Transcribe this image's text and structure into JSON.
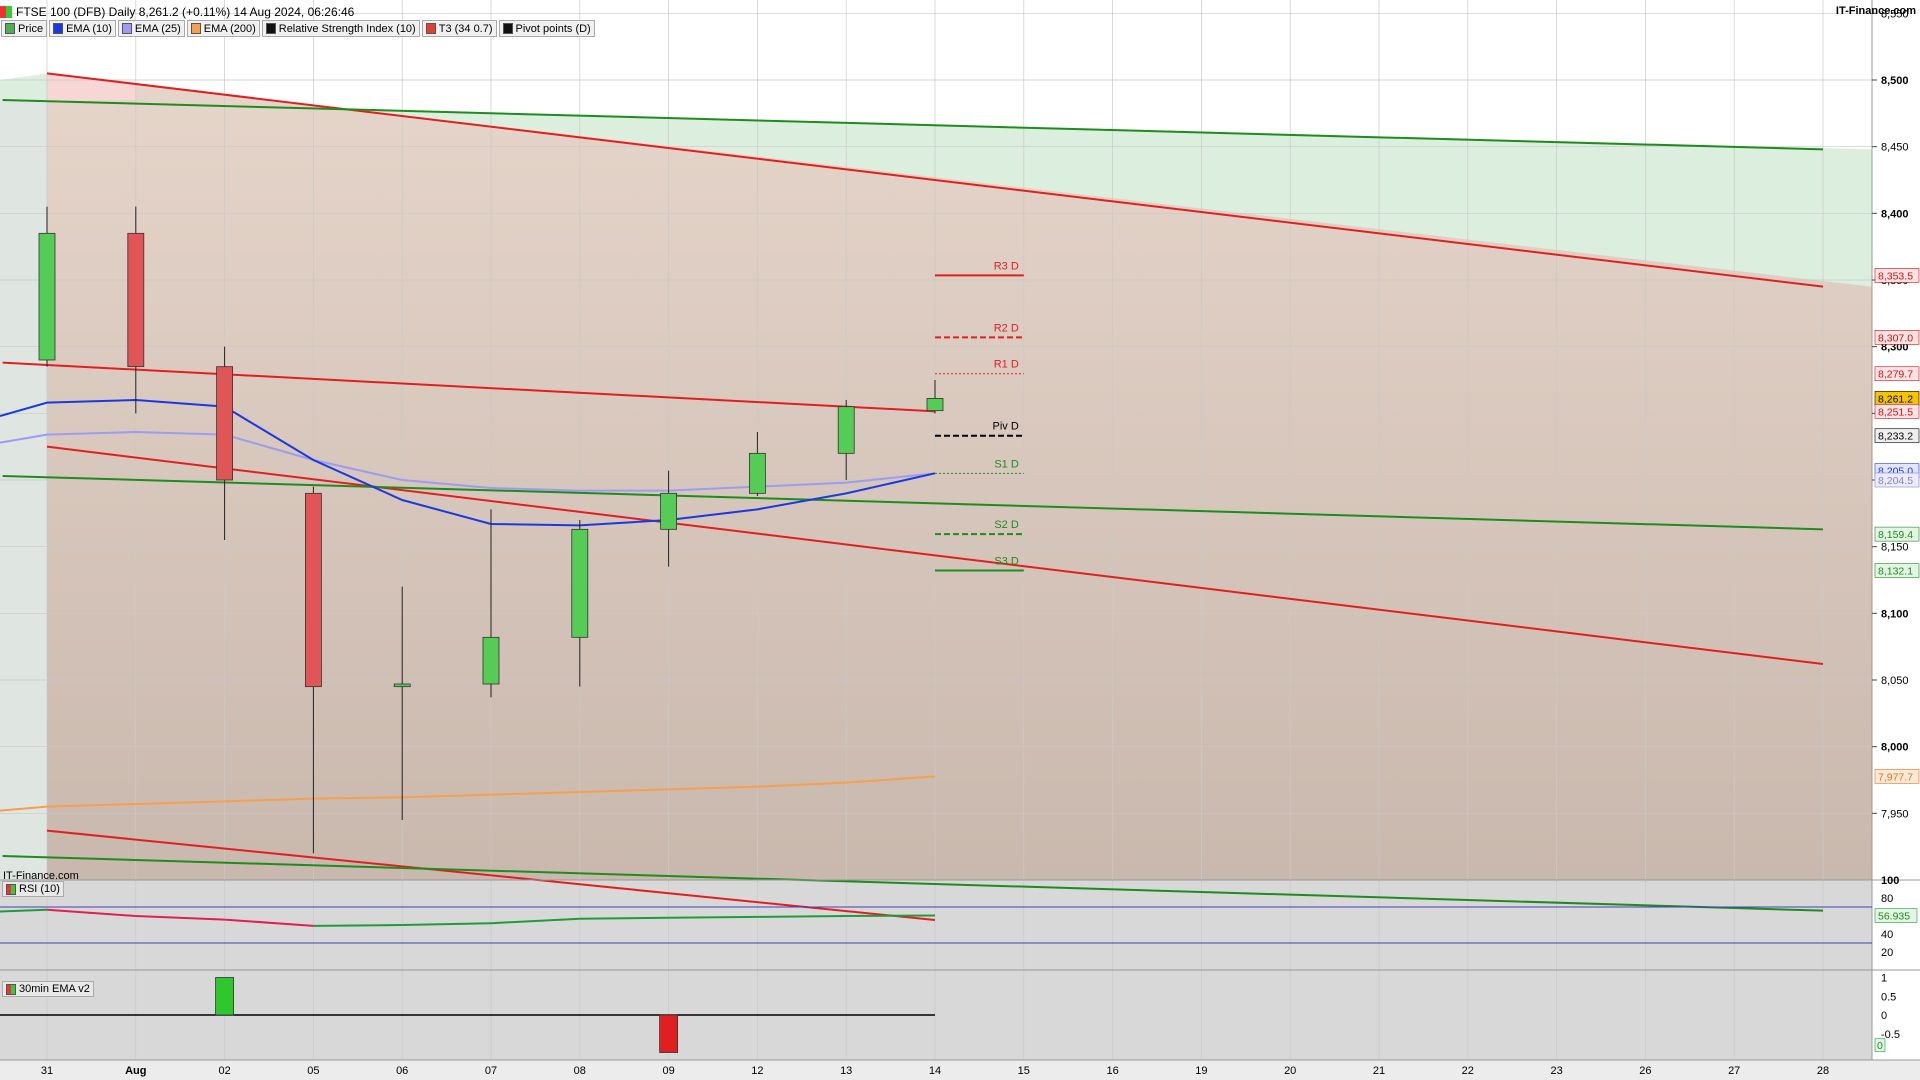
{
  "header": {
    "title": "FTSE 100 (DFB) Daily 8,261.2 (+0.11%) 14 Aug 2024, 06:26:46",
    "brand": "IT-Finance.com",
    "watermark": "IT-Finance.com"
  },
  "legend": [
    {
      "label": "Price",
      "color": "#4caf50"
    },
    {
      "label": "EMA (10)",
      "color": "#1a3ae0"
    },
    {
      "label": "EMA (25)",
      "color": "#9c9cf0"
    },
    {
      "label": "EMA (200)",
      "color": "#f5a050"
    },
    {
      "label": "Relative Strength Index (10)",
      "color": "#111111"
    },
    {
      "label": "T3 (34 0.7)",
      "color": "#e04030"
    },
    {
      "label": "Pivot points (D)",
      "color": "#111111"
    }
  ],
  "chart_data": {
    "type": "candlestick",
    "instrument": "FTSE 100 (DFB) Daily",
    "x_ticks": [
      "31",
      "Aug",
      "02",
      "05",
      "06",
      "07",
      "08",
      "09",
      "12",
      "13",
      "14",
      "15",
      "16",
      "19",
      "20",
      "21",
      "22",
      "23",
      "26",
      "27",
      "28"
    ],
    "ylim": [
      7900,
      8560
    ],
    "y_ticks": [
      "7,950",
      "8,000",
      "8,050",
      "8,100",
      "8,150",
      "8,200",
      "8,250",
      "8,300",
      "8,350",
      "8,400",
      "8,450",
      "8,500",
      "8,550"
    ],
    "candles": [
      {
        "date": "31",
        "open": 8290,
        "high": 8405,
        "low": 8285,
        "close": 8385
      },
      {
        "date": "Aug",
        "open": 8385,
        "high": 8405,
        "low": 8250,
        "close": 8285
      },
      {
        "date": "02",
        "open": 8285,
        "high": 8300,
        "low": 8155,
        "close": 8200
      },
      {
        "date": "05",
        "open": 8190,
        "high": 8195,
        "low": 7920,
        "close": 8045
      },
      {
        "date": "06",
        "open": 8045,
        "high": 8120,
        "low": 7945,
        "close": 8047
      },
      {
        "date": "07",
        "open": 8047,
        "high": 8178,
        "low": 8037,
        "close": 8082
      },
      {
        "date": "08",
        "open": 8082,
        "high": 8170,
        "low": 8045,
        "close": 8163
      },
      {
        "date": "09",
        "open": 8163,
        "high": 8207,
        "low": 8135,
        "close": 8190
      },
      {
        "date": "12",
        "open": 8190,
        "high": 8236,
        "low": 8188,
        "close": 8220
      },
      {
        "date": "13",
        "open": 8220,
        "high": 8260,
        "low": 8200,
        "close": 8255
      },
      {
        "date": "14",
        "open": 8252,
        "high": 8275,
        "low": 8250,
        "close": 8261.2
      }
    ],
    "ema10": [
      8248,
      8258,
      8260,
      8255,
      8215,
      8185,
      8167,
      8166,
      8170,
      8178,
      8190,
      8205
    ],
    "ema25": [
      8228,
      8234,
      8236,
      8234,
      8215,
      8200,
      8194,
      8192,
      8192,
      8195,
      8198,
      8205
    ],
    "ema200": [
      7952,
      7955,
      7957,
      7959,
      7961,
      7962,
      7964,
      7966,
      7968,
      7970,
      7973,
      7977.7
    ],
    "trend_lines": [
      {
        "color": "#e02020",
        "from": [
          "31",
          8505
        ],
        "to": [
          "28",
          8345
        ]
      },
      {
        "color": "#e02020",
        "from": [
          "31",
          8225
        ],
        "to": [
          "28",
          8062
        ]
      },
      {
        "color": "#e02020",
        "from": [
          "31",
          7937
        ],
        "to": [
          "10",
          7870
        ]
      },
      {
        "color": "#e02020",
        "from": [
          "-0.5",
          8288
        ],
        "to": [
          "14",
          8251.5
        ]
      },
      {
        "color": "#1e8c1e",
        "from": [
          "-0.5",
          8485
        ],
        "to": [
          "28",
          8448
        ]
      },
      {
        "color": "#1e8c1e",
        "from": [
          "-0.5",
          8203
        ],
        "to": [
          "28",
          8163
        ]
      },
      {
        "color": "#1e8c1e",
        "from": [
          "-0.5",
          7918
        ],
        "to": [
          "28",
          7877
        ]
      }
    ],
    "pivots": [
      {
        "label": "R3 D",
        "value": 8353.5,
        "color": "#e02020",
        "style": "solid"
      },
      {
        "label": "R2 D",
        "value": 8307.0,
        "color": "#e02020",
        "style": "dashed"
      },
      {
        "label": "R1 D",
        "value": 8279.7,
        "color": "#e02020",
        "style": "dotted"
      },
      {
        "label": "Piv D",
        "value": 8233.2,
        "color": "#000000",
        "style": "dashed"
      },
      {
        "label": "S1 D",
        "value": 8205.0,
        "color": "#1e8c1e",
        "style": "dotted"
      },
      {
        "label": "S2 D",
        "value": 8159.4,
        "color": "#1e8c1e",
        "style": "dashed"
      },
      {
        "label": "S3 D",
        "value": 8132.1,
        "color": "#1e8c1e",
        "style": "solid"
      }
    ],
    "price_tags": [
      {
        "text": "8,353.5",
        "value": 8353.5,
        "bg": "#fde3e3",
        "fg": "#d01010"
      },
      {
        "text": "8,307.0",
        "value": 8307.0,
        "bg": "#fde3e3",
        "fg": "#d01010"
      },
      {
        "text": "8,279.7",
        "value": 8279.7,
        "bg": "#fde3e3",
        "fg": "#d01010"
      },
      {
        "text": "8,261.2",
        "value": 8261.2,
        "bg": "#f5c400",
        "fg": "#000000"
      },
      {
        "text": "8,251.5",
        "value": 8251.5,
        "bg": "#fde3e3",
        "fg": "#d01010"
      },
      {
        "text": "8,233.2",
        "value": 8233.2,
        "bg": "#eeeeee",
        "fg": "#000000"
      },
      {
        "text": "8,205.0",
        "value": 8207,
        "bg": "#e3e6ff",
        "fg": "#1a3ae0"
      },
      {
        "text": "8,204.5",
        "value": 8200,
        "bg": "#ececff",
        "fg": "#8080e0"
      },
      {
        "text": "8,159.4",
        "value": 8159.4,
        "bg": "#e3f5e3",
        "fg": "#1e8c1e"
      },
      {
        "text": "8,132.1",
        "value": 8132.1,
        "bg": "#e3f5e3",
        "fg": "#1e8c1e"
      },
      {
        "text": "7,977.7",
        "value": 7977.7,
        "bg": "#fde9d6",
        "fg": "#e07020"
      }
    ],
    "rsi": {
      "label": "RSI (10)",
      "ylim": [
        0,
        100
      ],
      "y_ticks": [
        "100",
        "80",
        "60",
        "40",
        "20"
      ],
      "levels": [
        70,
        30
      ],
      "values": [
        65,
        67,
        60,
        56,
        49,
        50,
        52,
        57,
        58,
        59,
        60,
        60.5
      ],
      "last_tag": "56.935"
    },
    "ema30": {
      "label": "30min EMA v2",
      "ylim": [
        -1.2,
        1.2
      ],
      "y_ticks": [
        "1",
        "0.5",
        "0",
        "-0.5"
      ],
      "bars": [
        {
          "date": "02",
          "value": 1
        },
        {
          "date": "09",
          "value": -1
        }
      ],
      "last_tag": "0"
    }
  }
}
